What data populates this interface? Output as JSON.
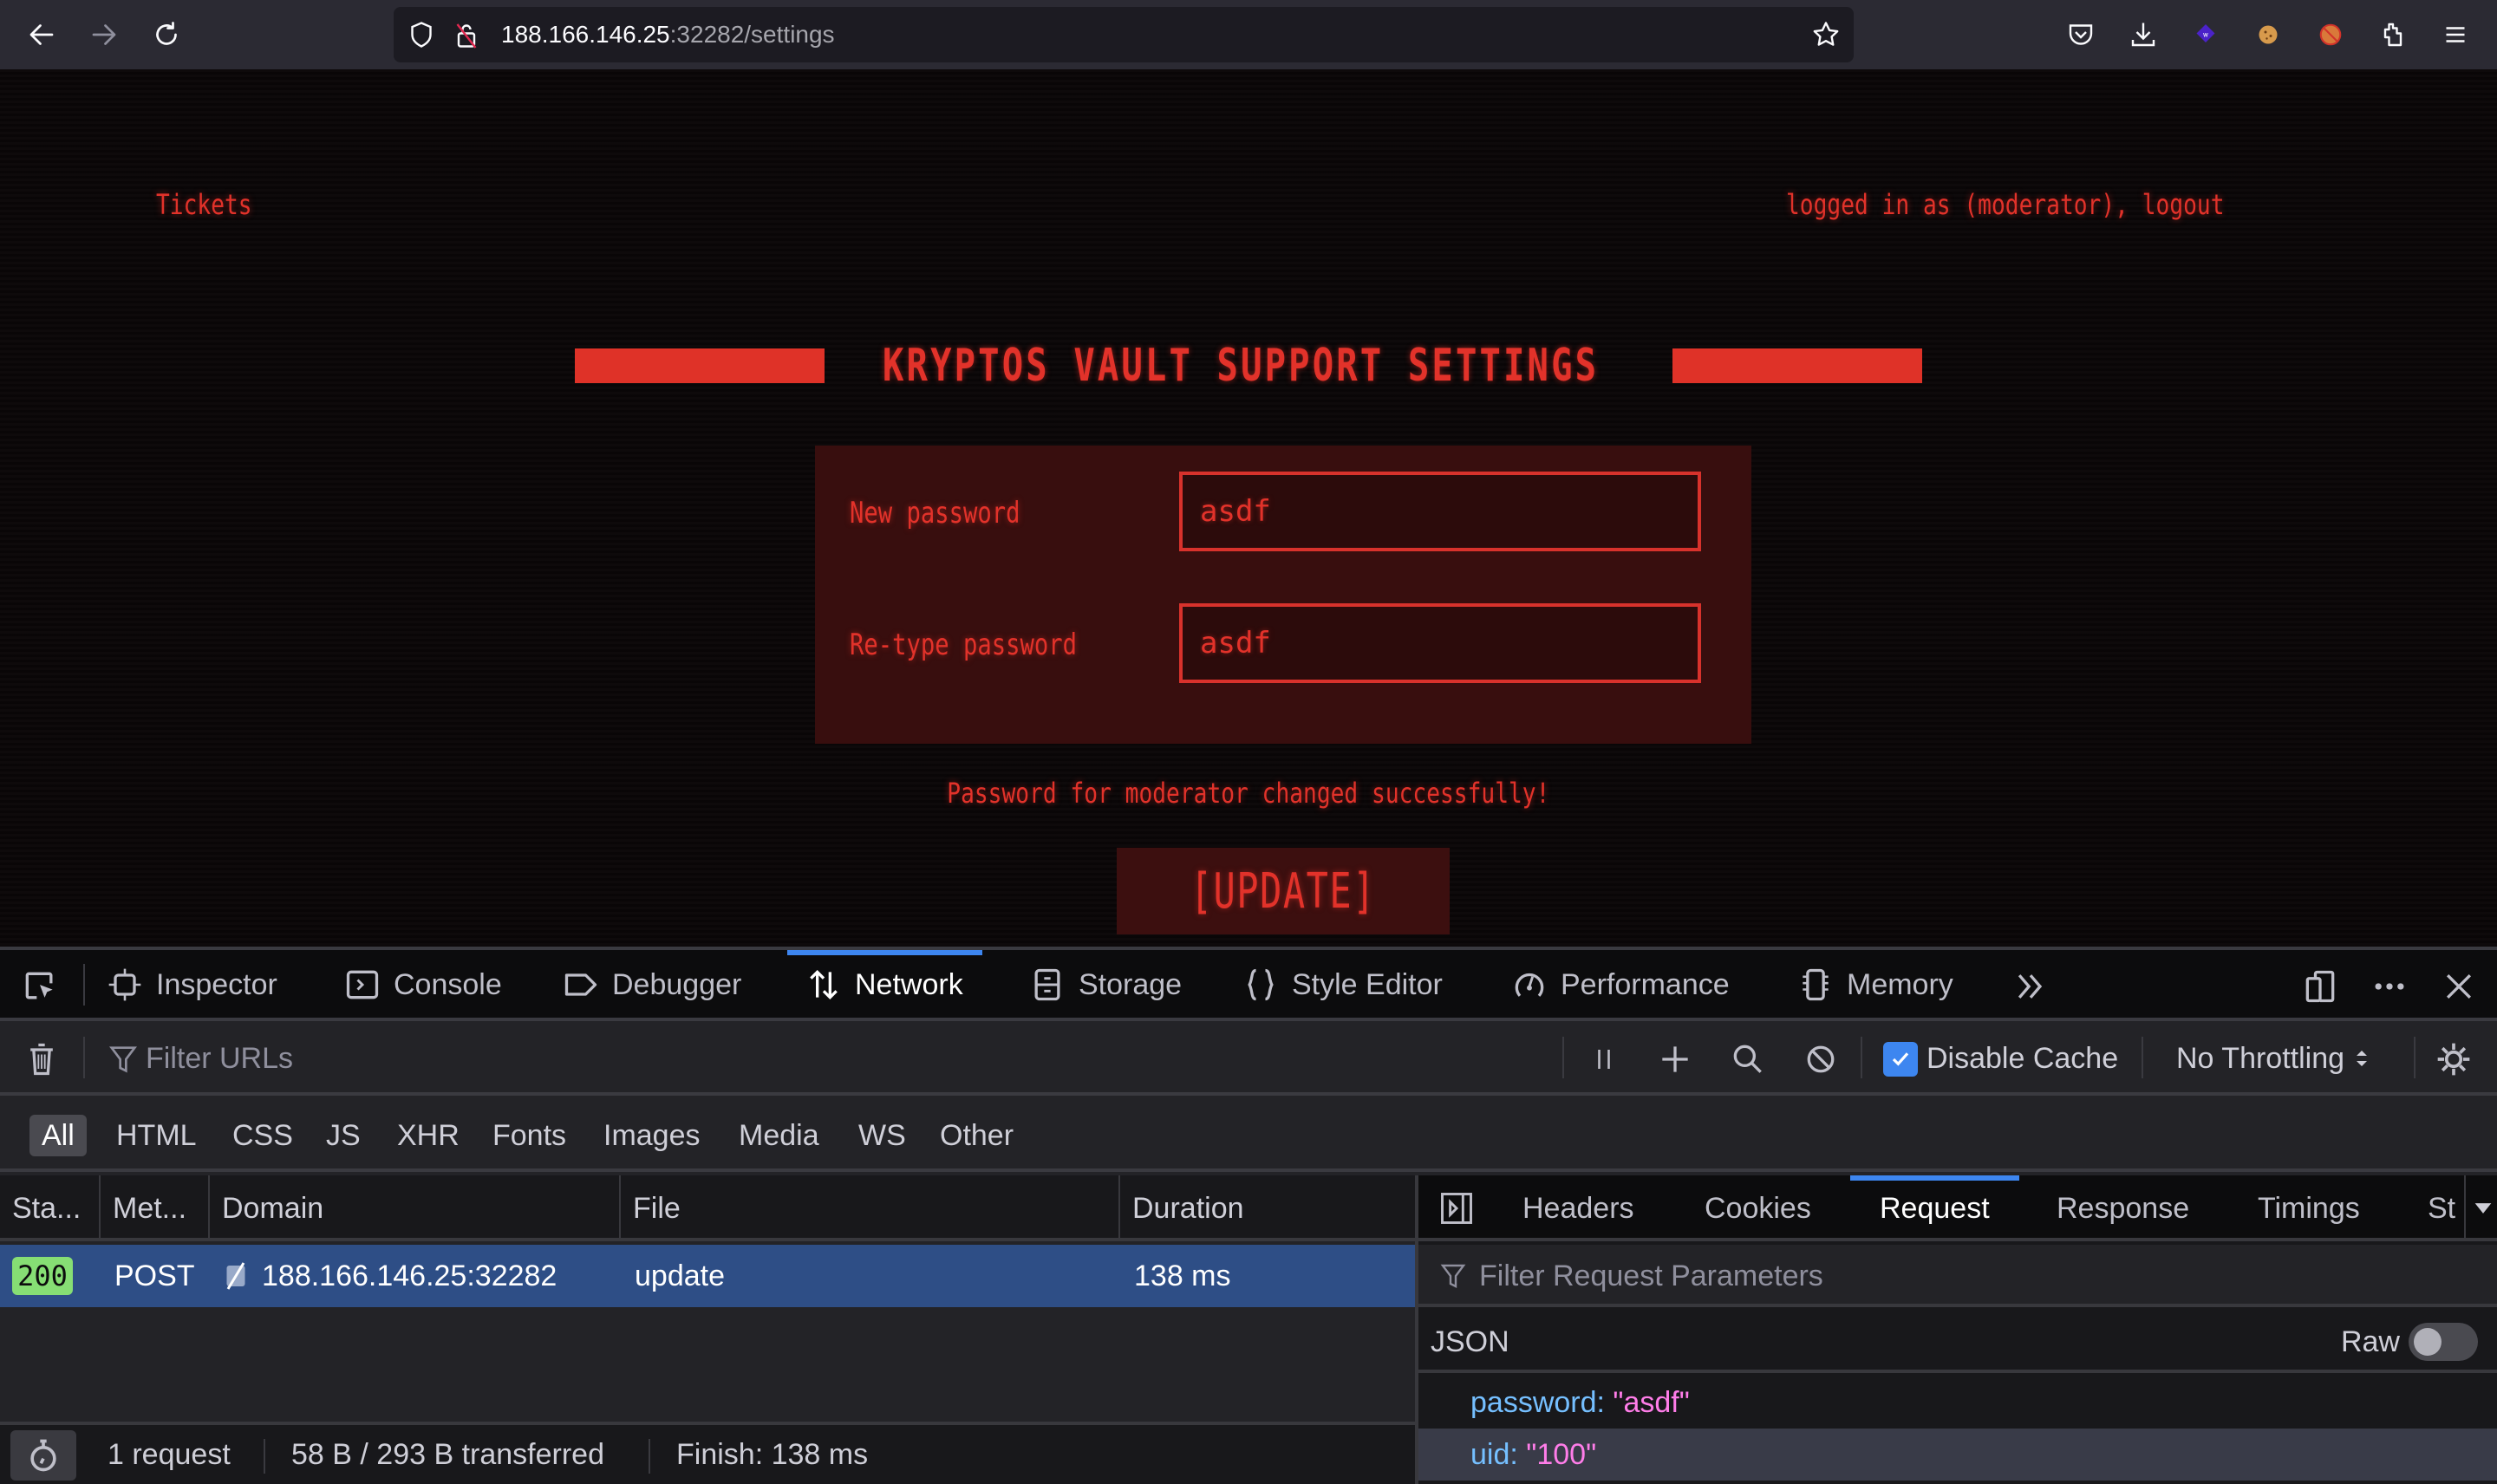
{
  "browser": {
    "url_host": "188.166.146.25",
    "url_path": ":32282/settings",
    "nav": {
      "back": "back-arrow-icon",
      "forward": "forward-arrow-icon",
      "reload": "reload-icon"
    },
    "toolbar_icons": [
      "pocket-icon",
      "download-icon",
      "wappalyzer-extension-icon",
      "cookie-extension-icon",
      "no-fox-extension-icon",
      "extensions-puzzle-icon",
      "hamburger-menu-icon"
    ]
  },
  "page": {
    "nav_left": "Tickets",
    "nav_right_prefix": "logged in as (moderator), ",
    "nav_right_logout": "logout",
    "title": "KRYPTOS VAULT SUPPORT SETTINGS",
    "form": {
      "new_password_label": "New password",
      "new_password_value": "asdf",
      "retype_password_label": "Re-type password",
      "retype_password_value": "asdf"
    },
    "success_message": "Password for moderator changed successfully!",
    "update_button": "[UPDATE]",
    "accent_color": "#e2322a"
  },
  "devtools": {
    "tabs": [
      {
        "label": "Inspector",
        "icon": "inspector-icon"
      },
      {
        "label": "Console",
        "icon": "console-icon"
      },
      {
        "label": "Debugger",
        "icon": "debugger-icon"
      },
      {
        "label": "Network",
        "icon": "network-arrows-icon",
        "active": true
      },
      {
        "label": "Storage",
        "icon": "storage-icon"
      },
      {
        "label": "Style Editor",
        "icon": "braces-icon"
      },
      {
        "label": "Performance",
        "icon": "gauge-icon"
      },
      {
        "label": "Memory",
        "icon": "memory-chip-icon"
      }
    ],
    "filter_placeholder": "Filter URLs",
    "disable_cache_label": "Disable Cache",
    "disable_cache_checked": true,
    "throttling": "No Throttling",
    "type_filters": [
      "All",
      "HTML",
      "CSS",
      "JS",
      "XHR",
      "Fonts",
      "Images",
      "Media",
      "WS",
      "Other"
    ],
    "active_type_filter": "All",
    "columns": [
      "Sta...",
      "Met...",
      "Domain",
      "File",
      "Duration"
    ],
    "requests": [
      {
        "status": "200",
        "method": "POST",
        "domain": "188.166.146.25:32282",
        "file": "update",
        "duration": "138 ms"
      }
    ],
    "footer": {
      "requests": "1 request",
      "transferred": "58 B / 293 B transferred",
      "finish": "Finish: 138 ms"
    },
    "side_tabs": [
      "Headers",
      "Cookies",
      "Request",
      "Response",
      "Timings",
      "St"
    ],
    "active_side_tab": "Request",
    "side_filter_placeholder": "Filter Request Parameters",
    "json_label": "JSON",
    "raw_label": "Raw",
    "raw_enabled": false,
    "params": [
      {
        "key": "password:",
        "value": "\"asdf\""
      },
      {
        "key": "uid:",
        "value": "\"100\""
      }
    ]
  }
}
